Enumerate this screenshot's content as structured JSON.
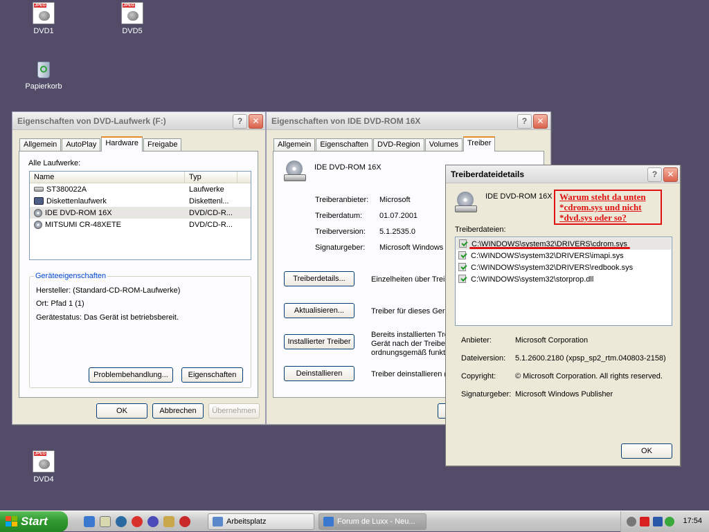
{
  "desktop": {
    "icons": [
      {
        "label": "DVD1",
        "icon": "jpeg-file-icon"
      },
      {
        "label": "DVD5",
        "icon": "jpeg-file-icon"
      },
      {
        "label": "Papierkorb",
        "icon": "recycle-bin-icon"
      },
      {
        "label": "DVD4",
        "icon": "jpeg-file-icon"
      }
    ],
    "background_color": "#524c68"
  },
  "win1": {
    "title": "Eigenschaften von DVD-Laufwerk (F:)",
    "tabs": [
      "Allgemein",
      "AutoPlay",
      "Hardware",
      "Freigabe"
    ],
    "selected_tab": "Hardware",
    "all_drives_label": "Alle Laufwerke:",
    "columns": [
      "Name",
      "Typ"
    ],
    "drives": [
      {
        "name": "ST380022A",
        "type": "Laufwerke",
        "icon": "hard-drive-icon"
      },
      {
        "name": "Diskettenlaufwerk",
        "type": "Diskettenl...",
        "icon": "floppy-drive-icon"
      },
      {
        "name": "IDE DVD-ROM 16X",
        "type": "DVD/CD-R...",
        "icon": "cd-drive-icon"
      },
      {
        "name": "MITSUMI CR-48XETE",
        "type": "DVD/CD-R...",
        "icon": "cd-drive-icon"
      }
    ],
    "group_title": "Geräteeigenschaften",
    "manufacturer": "Hersteller: (Standard-CD-ROM-Laufwerke)",
    "location": "Ort: Pfad 1 (1)",
    "status": "Gerätestatus: Das Gerät ist betriebsbereit.",
    "troubleshoot_btn": "Problembehandlung...",
    "properties_btn": "Eigenschaften",
    "ok_btn": "OK",
    "cancel_btn": "Abbrechen",
    "apply_btn": "Übernehmen"
  },
  "win2": {
    "title": "Eigenschaften von IDE DVD-ROM 16X",
    "tabs": [
      "Allgemein",
      "Eigenschaften",
      "DVD-Region",
      "Volumes",
      "Treiber"
    ],
    "selected_tab": "Treiber",
    "device_name": "IDE DVD-ROM 16X",
    "provider_label": "Treiberanbieter:",
    "provider_value": "Microsoft",
    "date_label": "Treiberdatum:",
    "date_value": "01.07.2001",
    "version_label": "Treiberversion:",
    "version_value": "5.1.2535.0",
    "signer_label": "Signaturgeber:",
    "signer_value": "Microsoft Windows I",
    "details_btn": "Treiberdetails...",
    "details_desc": "Einzelheiten über Treib",
    "update_btn": "Aktualisieren...",
    "update_desc": "Treiber für dieses Gerä",
    "rollback_btn": "Installierter Treiber",
    "rollback_desc_1": "Bereits installierten Trei",
    "rollback_desc_2": "Gerät nach der Treiber",
    "rollback_desc_3": "ordnungsgemäß funkti",
    "uninstall_btn": "Deinstallieren",
    "uninstall_desc": "Treiber deinstallieren (E"
  },
  "win3": {
    "title": "Treiberdateidetails",
    "device_name": "IDE DVD-ROM 16X",
    "files_label": "Treiberdateien:",
    "files": [
      "C:\\WINDOWS\\system32\\DRIVERS\\cdrom.sys",
      "C:\\WINDOWS\\system32\\DRIVERS\\imapi.sys",
      "C:\\WINDOWS\\system32\\DRIVERS\\redbook.sys",
      "C:\\WINDOWS\\system32\\storprop.dll"
    ],
    "provider_label": "Anbieter:",
    "provider_value": "Microsoft Corporation",
    "fileversion_label": "Dateiversion:",
    "fileversion_value": "5.1.2600.2180 (xpsp_sp2_rtm.040803-2158)",
    "copyright_label": "Copyright:",
    "copyright_value": "© Microsoft Corporation. All rights reserved.",
    "signer_label": "Signaturgeber:",
    "signer_value": "Microsoft Windows Publisher",
    "ok_btn": "OK"
  },
  "annotation": {
    "line1": "Warum steht da unten",
    "line2": "*cdrom.sys und nicht",
    "line3": "*dvd.sys oder so?",
    "color": "#e01010"
  },
  "taskbar": {
    "start_label": "Start",
    "tasks": [
      "Arbeitsplatz",
      "Forum de Luxx - Neu..."
    ],
    "clock": "17:54"
  }
}
